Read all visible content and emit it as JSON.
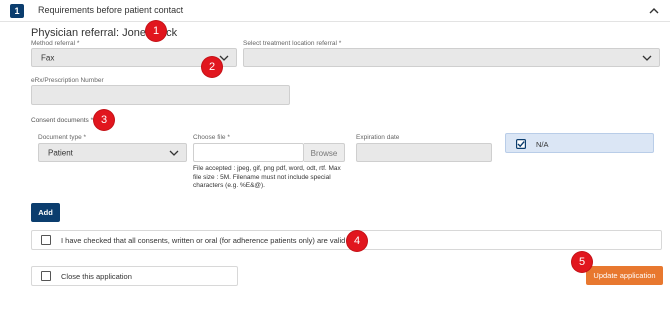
{
  "header": {
    "step_number": "1",
    "title": "Requirements before patient contact"
  },
  "referral": {
    "title": "Physician referral: Jones Jack"
  },
  "method_referral": {
    "label": "Method referral *",
    "value": "Fax"
  },
  "treatment_location": {
    "label": "Select treatment location referral *",
    "value": ""
  },
  "erx": {
    "label": "eRx/Prescription Number",
    "value": ""
  },
  "consent": {
    "section_label": "Consent documents *",
    "document_type": {
      "label": "Document type *",
      "value": "Patient"
    },
    "choose_file": {
      "label": "Choose file *",
      "value": "",
      "browse_label": "Browse"
    },
    "file_hint": "File accepted : jpeg, gif, png pdf, word, odt, rtf. Max file size : 5M. Filename must not include special characters (e.g. %E&@).",
    "expiration": {
      "label": "Expiration date",
      "value": ""
    },
    "na": {
      "label": "N/A",
      "checked": true
    }
  },
  "buttons": {
    "add_label": "Add",
    "update_label": "Update application"
  },
  "checks": {
    "consents_label": "I have checked that all consents, written or oral (for adherence patients only) are valid",
    "close_label": "Close this application"
  },
  "markers": [
    "1",
    "2",
    "3",
    "4",
    "5"
  ],
  "colors": {
    "primary": "#0b3d6e",
    "accent": "#e8782f",
    "marker": "#e1161e",
    "na_bg": "#dbe6f5"
  }
}
